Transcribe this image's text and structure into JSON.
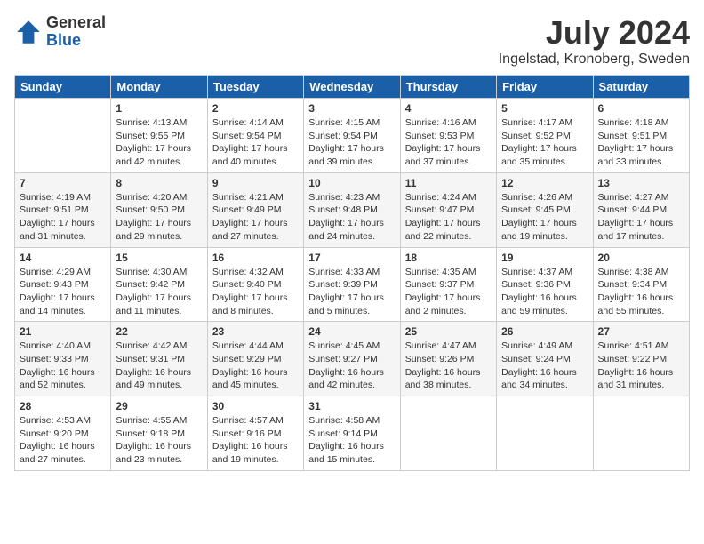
{
  "logo": {
    "general": "General",
    "blue": "Blue"
  },
  "title": {
    "month": "July 2024",
    "location": "Ingelstad, Kronoberg, Sweden"
  },
  "weekdays": [
    "Sunday",
    "Monday",
    "Tuesday",
    "Wednesday",
    "Thursday",
    "Friday",
    "Saturday"
  ],
  "weeks": [
    [
      {
        "day": "",
        "info": ""
      },
      {
        "day": "1",
        "info": "Sunrise: 4:13 AM\nSunset: 9:55 PM\nDaylight: 17 hours\nand 42 minutes."
      },
      {
        "day": "2",
        "info": "Sunrise: 4:14 AM\nSunset: 9:54 PM\nDaylight: 17 hours\nand 40 minutes."
      },
      {
        "day": "3",
        "info": "Sunrise: 4:15 AM\nSunset: 9:54 PM\nDaylight: 17 hours\nand 39 minutes."
      },
      {
        "day": "4",
        "info": "Sunrise: 4:16 AM\nSunset: 9:53 PM\nDaylight: 17 hours\nand 37 minutes."
      },
      {
        "day": "5",
        "info": "Sunrise: 4:17 AM\nSunset: 9:52 PM\nDaylight: 17 hours\nand 35 minutes."
      },
      {
        "day": "6",
        "info": "Sunrise: 4:18 AM\nSunset: 9:51 PM\nDaylight: 17 hours\nand 33 minutes."
      }
    ],
    [
      {
        "day": "7",
        "info": "Sunrise: 4:19 AM\nSunset: 9:51 PM\nDaylight: 17 hours\nand 31 minutes."
      },
      {
        "day": "8",
        "info": "Sunrise: 4:20 AM\nSunset: 9:50 PM\nDaylight: 17 hours\nand 29 minutes."
      },
      {
        "day": "9",
        "info": "Sunrise: 4:21 AM\nSunset: 9:49 PM\nDaylight: 17 hours\nand 27 minutes."
      },
      {
        "day": "10",
        "info": "Sunrise: 4:23 AM\nSunset: 9:48 PM\nDaylight: 17 hours\nand 24 minutes."
      },
      {
        "day": "11",
        "info": "Sunrise: 4:24 AM\nSunset: 9:47 PM\nDaylight: 17 hours\nand 22 minutes."
      },
      {
        "day": "12",
        "info": "Sunrise: 4:26 AM\nSunset: 9:45 PM\nDaylight: 17 hours\nand 19 minutes."
      },
      {
        "day": "13",
        "info": "Sunrise: 4:27 AM\nSunset: 9:44 PM\nDaylight: 17 hours\nand 17 minutes."
      }
    ],
    [
      {
        "day": "14",
        "info": "Sunrise: 4:29 AM\nSunset: 9:43 PM\nDaylight: 17 hours\nand 14 minutes."
      },
      {
        "day": "15",
        "info": "Sunrise: 4:30 AM\nSunset: 9:42 PM\nDaylight: 17 hours\nand 11 minutes."
      },
      {
        "day": "16",
        "info": "Sunrise: 4:32 AM\nSunset: 9:40 PM\nDaylight: 17 hours\nand 8 minutes."
      },
      {
        "day": "17",
        "info": "Sunrise: 4:33 AM\nSunset: 9:39 PM\nDaylight: 17 hours\nand 5 minutes."
      },
      {
        "day": "18",
        "info": "Sunrise: 4:35 AM\nSunset: 9:37 PM\nDaylight: 17 hours\nand 2 minutes."
      },
      {
        "day": "19",
        "info": "Sunrise: 4:37 AM\nSunset: 9:36 PM\nDaylight: 16 hours\nand 59 minutes."
      },
      {
        "day": "20",
        "info": "Sunrise: 4:38 AM\nSunset: 9:34 PM\nDaylight: 16 hours\nand 55 minutes."
      }
    ],
    [
      {
        "day": "21",
        "info": "Sunrise: 4:40 AM\nSunset: 9:33 PM\nDaylight: 16 hours\nand 52 minutes."
      },
      {
        "day": "22",
        "info": "Sunrise: 4:42 AM\nSunset: 9:31 PM\nDaylight: 16 hours\nand 49 minutes."
      },
      {
        "day": "23",
        "info": "Sunrise: 4:44 AM\nSunset: 9:29 PM\nDaylight: 16 hours\nand 45 minutes."
      },
      {
        "day": "24",
        "info": "Sunrise: 4:45 AM\nSunset: 9:27 PM\nDaylight: 16 hours\nand 42 minutes."
      },
      {
        "day": "25",
        "info": "Sunrise: 4:47 AM\nSunset: 9:26 PM\nDaylight: 16 hours\nand 38 minutes."
      },
      {
        "day": "26",
        "info": "Sunrise: 4:49 AM\nSunset: 9:24 PM\nDaylight: 16 hours\nand 34 minutes."
      },
      {
        "day": "27",
        "info": "Sunrise: 4:51 AM\nSunset: 9:22 PM\nDaylight: 16 hours\nand 31 minutes."
      }
    ],
    [
      {
        "day": "28",
        "info": "Sunrise: 4:53 AM\nSunset: 9:20 PM\nDaylight: 16 hours\nand 27 minutes."
      },
      {
        "day": "29",
        "info": "Sunrise: 4:55 AM\nSunset: 9:18 PM\nDaylight: 16 hours\nand 23 minutes."
      },
      {
        "day": "30",
        "info": "Sunrise: 4:57 AM\nSunset: 9:16 PM\nDaylight: 16 hours\nand 19 minutes."
      },
      {
        "day": "31",
        "info": "Sunrise: 4:58 AM\nSunset: 9:14 PM\nDaylight: 16 hours\nand 15 minutes."
      },
      {
        "day": "",
        "info": ""
      },
      {
        "day": "",
        "info": ""
      },
      {
        "day": "",
        "info": ""
      }
    ]
  ]
}
